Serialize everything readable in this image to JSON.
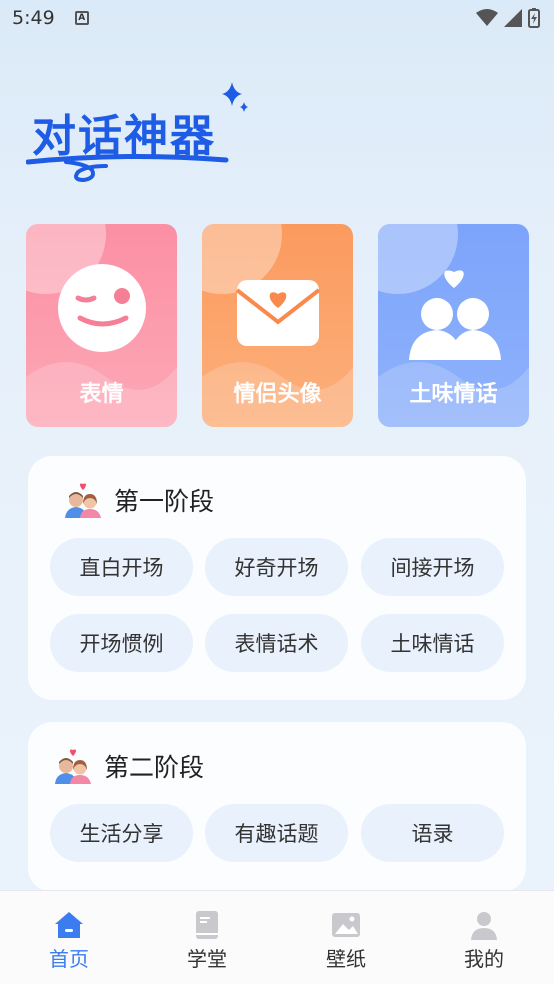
{
  "status_bar": {
    "time": "5:49",
    "notif_letter": "A"
  },
  "hero": {
    "title": "对话神器"
  },
  "feature_cards": [
    {
      "label": "表情",
      "icon": "wink-face-icon",
      "color": "#fb8fa3"
    },
    {
      "label": "情侣头像",
      "icon": "heart-envelope-icon",
      "color": "#fb9a5e"
    },
    {
      "label": "土味情话",
      "icon": "couple-heart-icon",
      "color": "#7ca4fb"
    }
  ],
  "stages": [
    {
      "title": "第一阶段",
      "icon": "couple-avatar-icon",
      "chips": [
        "直白开场",
        "好奇开场",
        "间接开场",
        "开场惯例",
        "表情话术",
        "土味情话"
      ]
    },
    {
      "title": "第二阶段",
      "icon": "couple-avatar-icon",
      "chips": [
        "生活分享",
        "有趣话题",
        "语录"
      ]
    }
  ],
  "tabs": [
    {
      "label": "首页",
      "icon": "home-icon",
      "active": true
    },
    {
      "label": "学堂",
      "icon": "book-icon",
      "active": false
    },
    {
      "label": "壁纸",
      "icon": "image-icon",
      "active": false
    },
    {
      "label": "我的",
      "icon": "user-icon",
      "active": false
    }
  ],
  "colors": {
    "accent": "#3b7cf0",
    "title": "#1f5ce5",
    "chip_bg": "#e9f1fc"
  }
}
